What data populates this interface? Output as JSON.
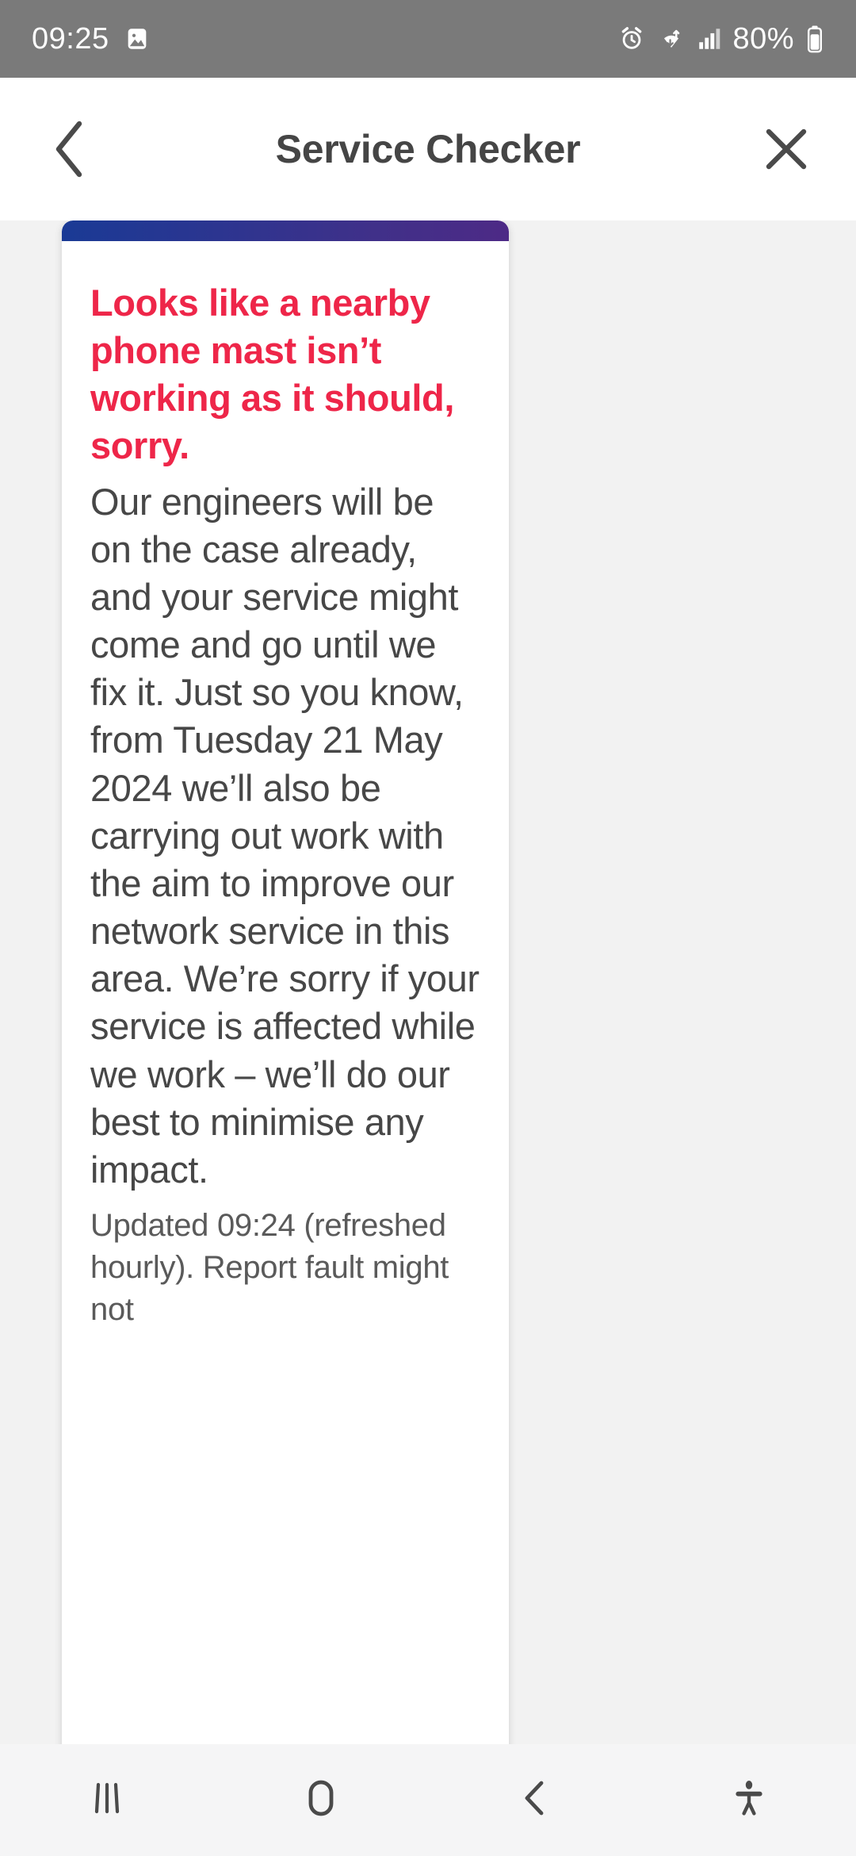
{
  "status_bar": {
    "time": "09:25",
    "battery_percent": "80%",
    "icons": {
      "gallery": "image-icon",
      "alarm": "alarm-icon",
      "wifi": "wifi-icon",
      "signal": "cellular-signal-icon",
      "battery": "battery-icon"
    }
  },
  "header": {
    "title": "Service Checker",
    "back_label": "‹",
    "close_label": "✕"
  },
  "card": {
    "accent_gradient_from": "#1a3a95",
    "accent_gradient_to": "#4d2a86",
    "alert_color": "#ee2649",
    "body_color": "#474747",
    "alert_title": "Looks like a nearby phone mast isn’t working as it should, sorry.",
    "alert_text": "Our engineers will be on the case already, and your service might come and go until we fix it. Just so you know, from Tuesday 21 May 2024 we’ll also be carrying out work with the aim to improve our network service in this area. We’re sorry if your service is affected while we work – we’ll do our best to minimise any impact.",
    "updated_text": "Updated 09:24 (refreshed hourly). Report fault might not"
  },
  "nav_bar": {
    "recents_label": "recents-icon",
    "home_label": "home-icon",
    "back_label": "back-icon",
    "accessibility_label": "accessibility-icon"
  }
}
